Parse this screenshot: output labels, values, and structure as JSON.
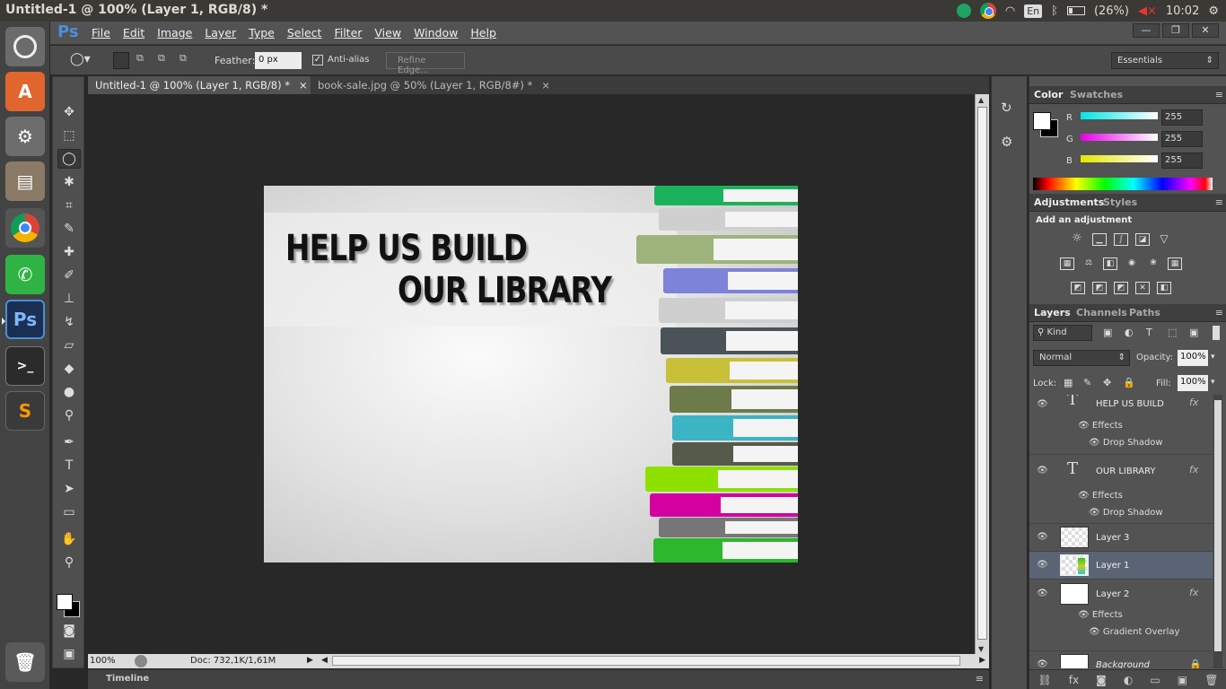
{
  "window": {
    "title": "Untitled-1 @ 100% (Layer 1, RGB/8) *"
  },
  "tray": {
    "lang": "En",
    "battery": "(26%)",
    "time": "10:02"
  },
  "launcher": {
    "items": [
      "Ubuntu",
      "Software Center",
      "System Settings",
      "Files",
      "Chrome",
      "WhatsApp",
      "Ps",
      "Terminal",
      "Sublime Text",
      "Trash"
    ]
  },
  "menubar": {
    "app_logo": "Ps",
    "items": [
      "File",
      "Edit",
      "Image",
      "Layer",
      "Type",
      "Select",
      "Filter",
      "View",
      "Window",
      "Help"
    ]
  },
  "options": {
    "feather_label": "Feather:",
    "feather_value": "0 px",
    "antialias_label": "Anti-alias",
    "antialias_checked": true,
    "refine_edge": "Refine Edge...",
    "workspace": "Essentials"
  },
  "tabs": [
    {
      "label": "Untitled-1 @ 100% (Layer 1, RGB/8) *"
    },
    {
      "label": "book-sale.jpg @ 50% (Layer 1, RGB/8#) *"
    }
  ],
  "canvas": {
    "headline_1": "HELP US BUILD",
    "headline_2": "OUR LIBRARY"
  },
  "status": {
    "zoom": "100%",
    "doc": "Doc: 732,1K/1,61M"
  },
  "timeline": {
    "label": "Timeline"
  },
  "color_panel": {
    "tabs": [
      "Color",
      "Swatches"
    ],
    "channels": [
      {
        "name": "R",
        "value": "255",
        "color": "#00e5e5"
      },
      {
        "name": "G",
        "value": "255",
        "color": "#e600e6"
      },
      {
        "name": "B",
        "value": "255",
        "color": "#e6e600"
      }
    ]
  },
  "adjustments_panel": {
    "tabs": [
      "Adjustments",
      "Styles"
    ],
    "heading": "Add an adjustment"
  },
  "layers_panel": {
    "tabs": [
      "Layers",
      "Channels",
      "Paths"
    ],
    "kind_label": "Kind",
    "blend_mode": "Normal",
    "opacity_label": "Opacity:",
    "opacity_value": "100%",
    "lock_label": "Lock:",
    "fill_label": "Fill:",
    "fill_value": "100%",
    "layers": [
      {
        "name": "HELP US BUILD",
        "type": "text",
        "effects_label": "Effects",
        "effect": "Drop Shadow"
      },
      {
        "name": "OUR LIBRARY",
        "type": "text",
        "effects_label": "Effects",
        "effect": "Drop Shadow"
      },
      {
        "name": "Layer 3",
        "type": "pixel"
      },
      {
        "name": "Layer 1",
        "type": "pixel",
        "selected": true
      },
      {
        "name": "Layer 2",
        "type": "pixel",
        "effects_label": "Effects",
        "effect": "Gradient Overlay"
      },
      {
        "name": "Background",
        "type": "background",
        "locked": true
      }
    ]
  },
  "colors": {
    "ps_blue": "#4a8fd9",
    "selected_layer": "#5a6474"
  }
}
